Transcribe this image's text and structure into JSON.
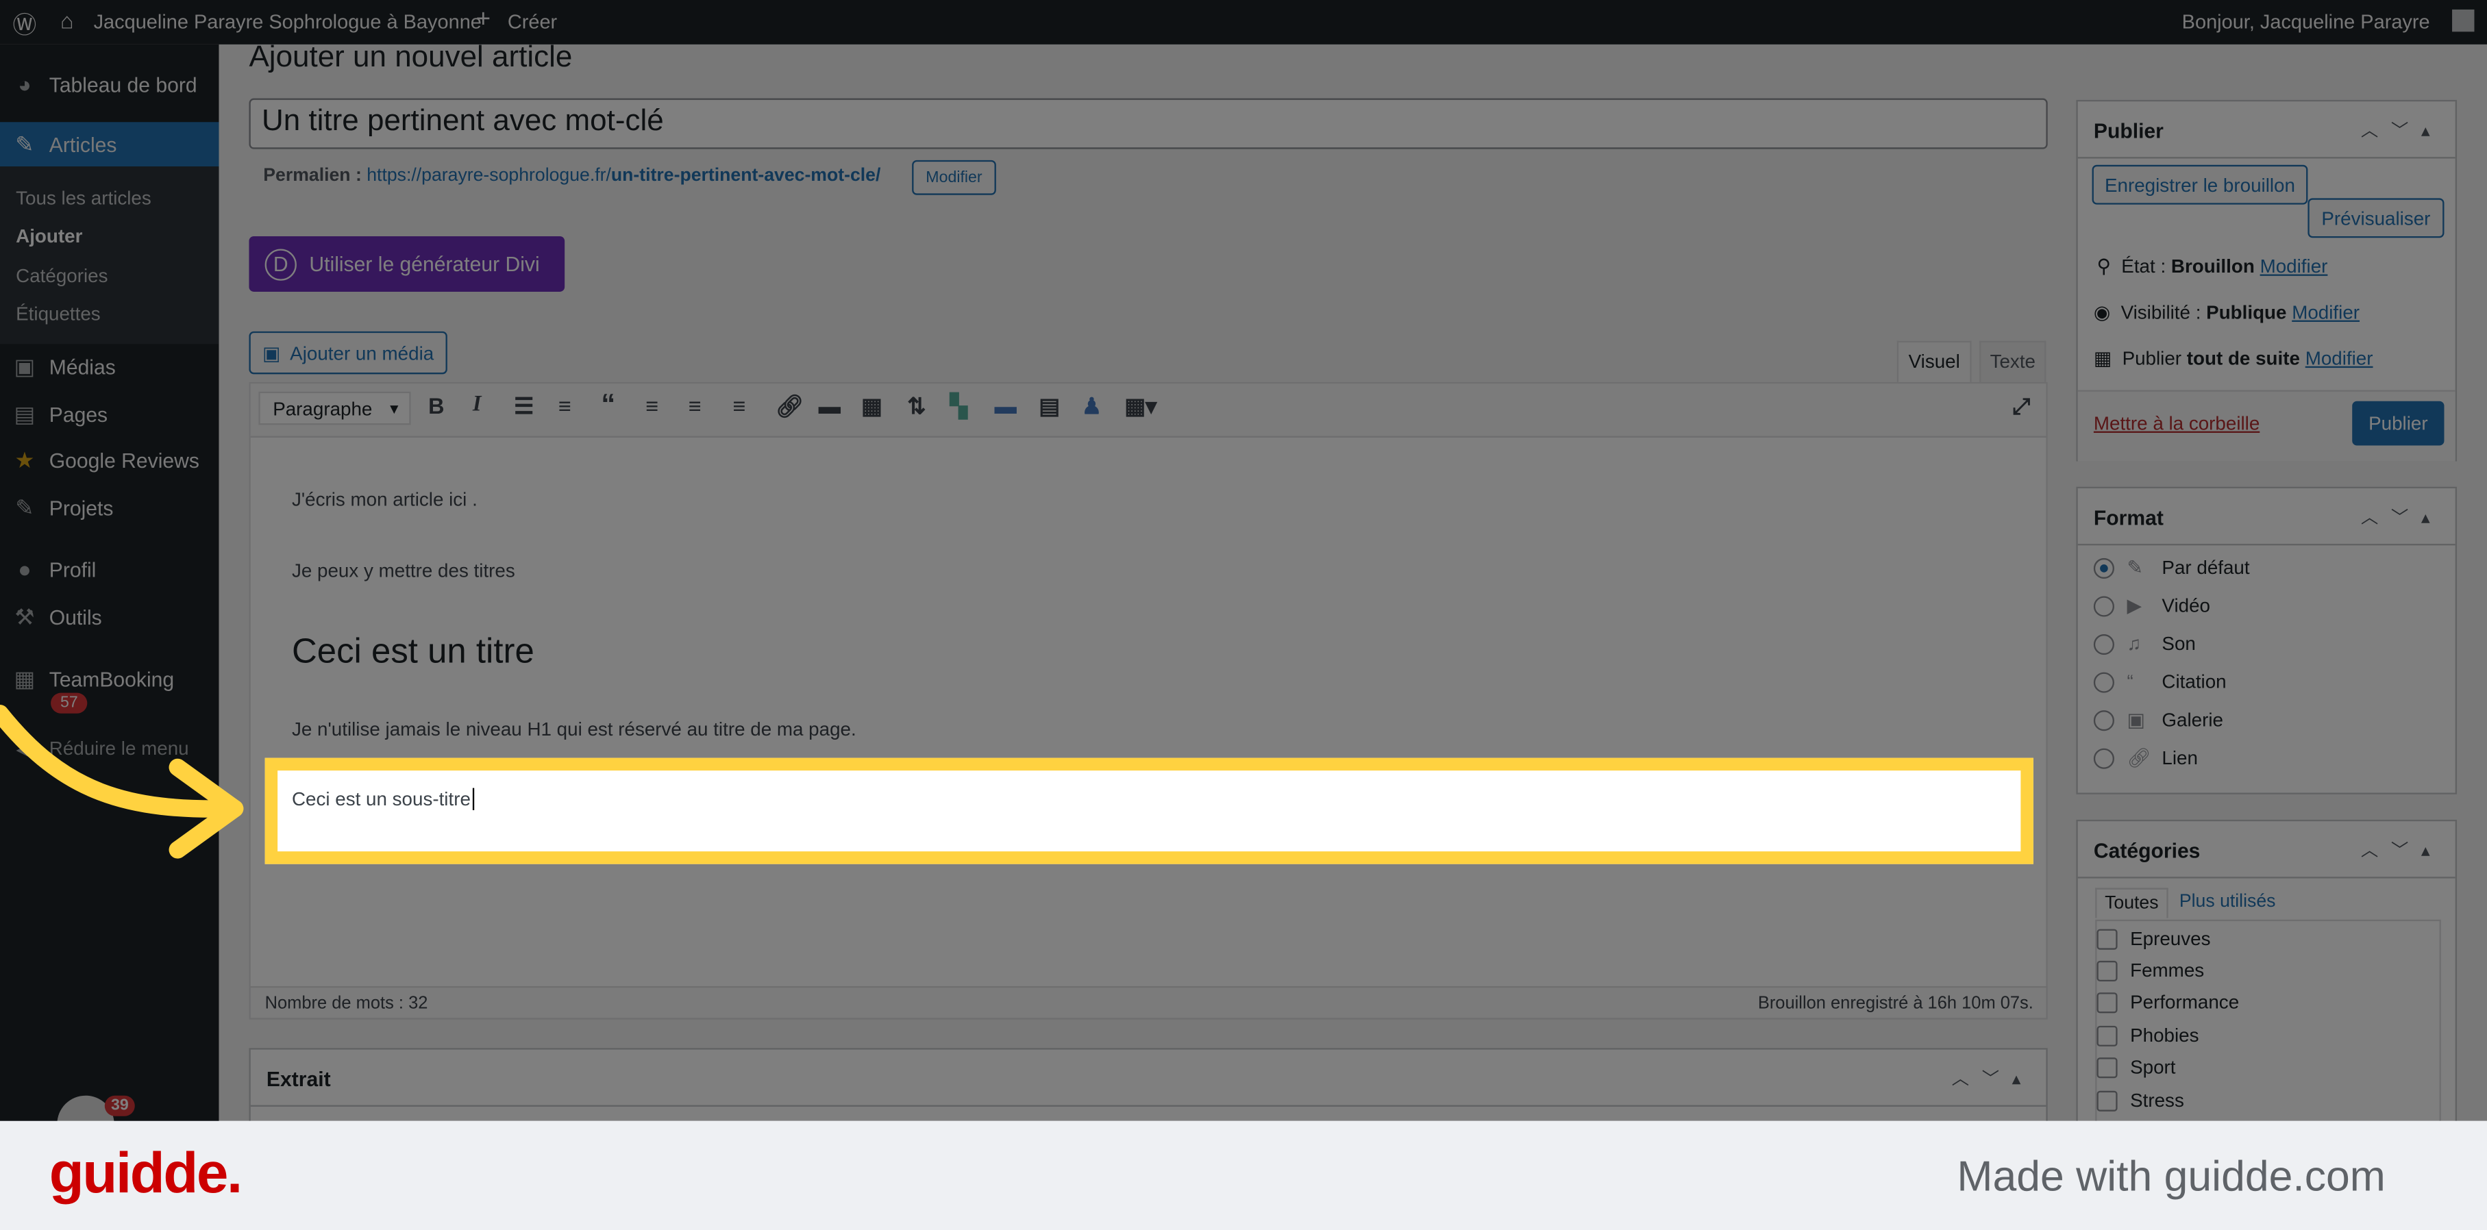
{
  "adminbar": {
    "site": "Jacqueline Parayre Sophrologue à Bayonne",
    "create": "Créer",
    "greeting": "Bonjour, Jacqueline Parayre"
  },
  "sidebar": {
    "items": [
      {
        "label": "Tableau de bord",
        "icon": "dashboard-icon"
      },
      {
        "label": "Articles",
        "icon": "pin-icon"
      },
      {
        "label": "Médias",
        "icon": "media-icon"
      },
      {
        "label": "Pages",
        "icon": "pages-icon"
      },
      {
        "label": "Google Reviews",
        "icon": "star-icon"
      },
      {
        "label": "Projets",
        "icon": "pin-icon"
      },
      {
        "label": "Profil",
        "icon": "user-icon"
      },
      {
        "label": "Outils",
        "icon": "wrench-icon"
      },
      {
        "label": "TeamBooking",
        "icon": "calendar-icon",
        "badge": "57"
      },
      {
        "label": "Réduire le menu",
        "icon": "collapse-icon"
      }
    ],
    "sub": [
      "Tous les articles",
      "Ajouter",
      "Catégories",
      "Étiquettes"
    ],
    "bottom_badge": "39"
  },
  "page": {
    "title": "Ajouter un nouvel article",
    "post_title": "Un titre pertinent avec mot-clé",
    "permalink_label": "Permalien :",
    "permalink_base": "https://parayre-sophrologue.fr/",
    "permalink_slug": "un-titre-pertinent-avec-mot-cle/",
    "permalink_edit": "Modifier",
    "divi_button": "Utiliser le générateur Divi",
    "divi_letter": "D",
    "add_media": "Ajouter un média"
  },
  "editor": {
    "tabs": [
      "Visuel",
      "Texte"
    ],
    "format_select": "Paragraphe",
    "content": [
      "J'écris mon article ici .",
      "Je peux y mettre des titres",
      "Ceci est un titre",
      "Je n'utilise jamais le niveau H1 qui est réservé au titre de ma page.",
      "Ceci est un sous-titre"
    ],
    "word_count": "Nombre de mots : 32",
    "saved": "Brouillon enregistré à 16h 10m 07s."
  },
  "excerpt": {
    "title": "Extrait"
  },
  "publish": {
    "title": "Publier",
    "save_draft": "Enregistrer le brouillon",
    "preview": "Prévisualiser",
    "status_label": "État :",
    "status": "Brouillon",
    "visibility_label": "Visibilité :",
    "visibility": "Publique",
    "schedule_label": "Publier",
    "schedule": "tout de suite",
    "edit": "Modifier",
    "trash": "Mettre à la corbeille",
    "publish": "Publier"
  },
  "format": {
    "title": "Format",
    "options": [
      "Par défaut",
      "Vidéo",
      "Son",
      "Citation",
      "Galerie",
      "Lien"
    ],
    "selected": "Par défaut"
  },
  "categories": {
    "title": "Catégories",
    "tabs": [
      "Toutes",
      "Plus utilisés"
    ],
    "items": [
      "Epreuves",
      "Femmes",
      "Performance",
      "Phobies",
      "Sport",
      "Stress"
    ]
  },
  "footer": {
    "logo": "guidde.",
    "made_with": "Made with guidde.com"
  },
  "colors": {
    "highlight": "#ffd240",
    "brand": "#cc0000",
    "accent": "#2271b1",
    "divi": "#6c2eb9"
  }
}
